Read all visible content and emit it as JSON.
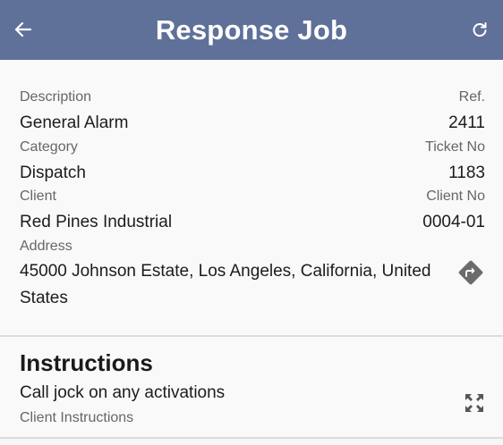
{
  "header": {
    "title": "Response Job",
    "back_icon": "arrow-left-icon",
    "refresh_icon": "refresh-icon"
  },
  "details": {
    "description_label": "Description",
    "description_value": "General Alarm",
    "ref_label": "Ref.",
    "ref_value": "2411",
    "category_label": "Category",
    "category_value": "Dispatch",
    "ticket_label": "Ticket No",
    "ticket_value": "1183",
    "client_label": "Client",
    "client_value": "Red Pines Industrial",
    "client_no_label": "Client No",
    "client_no_value": "0004-01",
    "address_label": "Address",
    "address_value": "45000 Johnson Estate, Los Angeles, California, United States",
    "directions_icon": "directions-icon"
  },
  "instructions": {
    "heading": "Instructions",
    "text": "Call jock on any activations",
    "subtext": "Client Instructions",
    "expand_icon": "expand-icon"
  },
  "colors": {
    "header_bg": "#5f7099",
    "header_text": "#ffffff",
    "background": "#f9f9f9",
    "label": "#666666"
  }
}
